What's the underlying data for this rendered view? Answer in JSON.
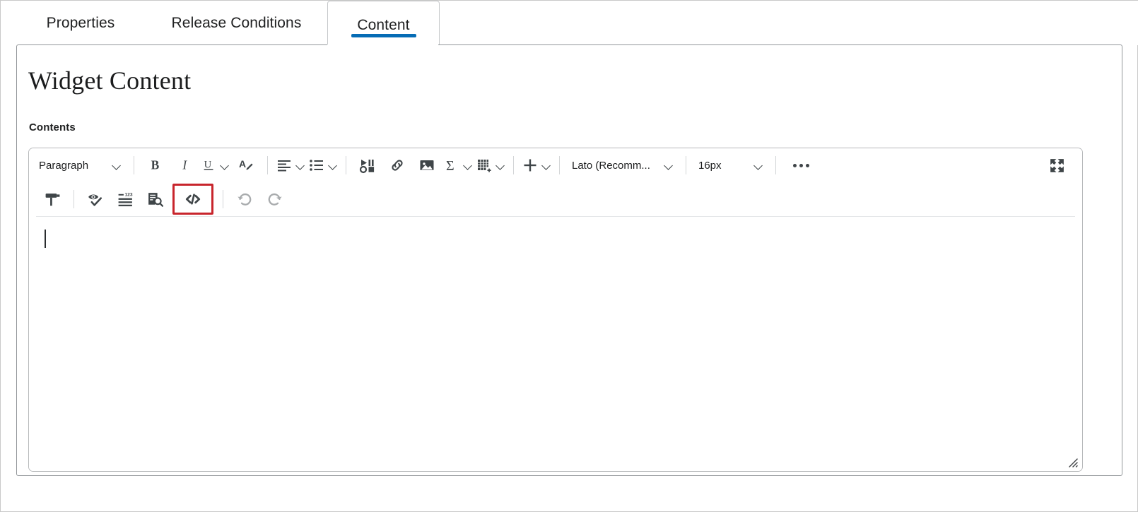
{
  "tabs": [
    {
      "id": "properties",
      "label": "Properties",
      "active": false
    },
    {
      "id": "release_conditions",
      "label": "Release Conditions",
      "active": false
    },
    {
      "id": "content",
      "label": "Content",
      "active": true
    }
  ],
  "panel": {
    "title": "Widget Content",
    "field_label": "Contents"
  },
  "editor": {
    "toolbar_row_1": [
      {
        "name": "paragraph-style-select",
        "type": "select",
        "value": "Paragraph"
      },
      {
        "name": "bold-button",
        "type": "icon",
        "icon": "bold-icon",
        "tooltip": "Bold"
      },
      {
        "name": "italic-button",
        "type": "icon",
        "icon": "italic-icon",
        "tooltip": "Italic"
      },
      {
        "name": "underline-button",
        "type": "split",
        "icon": "underline-icon",
        "tooltip": "Underline"
      },
      {
        "name": "text-color-button",
        "type": "icon",
        "icon": "text-color-icon",
        "tooltip": "Font Color"
      },
      {
        "name": "align-button",
        "type": "split",
        "icon": "align-left-icon",
        "tooltip": "Alignment"
      },
      {
        "name": "list-button",
        "type": "split",
        "icon": "bulleted-list-icon",
        "tooltip": "Lists"
      },
      {
        "name": "insert-media-button",
        "type": "icon",
        "icon": "media-icon",
        "tooltip": "Insert Stuff"
      },
      {
        "name": "insert-link-button",
        "type": "icon",
        "icon": "link-icon",
        "tooltip": "Insert Quicklink"
      },
      {
        "name": "insert-image-button",
        "type": "icon",
        "icon": "image-icon",
        "tooltip": "Insert Image"
      },
      {
        "name": "insert-equation-button",
        "type": "split",
        "icon": "sigma-icon",
        "tooltip": "Insert Equation"
      },
      {
        "name": "insert-table-button",
        "type": "split",
        "icon": "table-icon",
        "tooltip": "Insert Table"
      },
      {
        "name": "insert-more-button",
        "type": "split",
        "icon": "plus-icon",
        "tooltip": "Insert"
      },
      {
        "name": "font-family-select",
        "type": "select",
        "value": "Lato (Recomm..."
      },
      {
        "name": "font-size-select",
        "type": "select",
        "value": "16px"
      },
      {
        "name": "more-options-button",
        "type": "icon",
        "icon": "ellipsis-icon",
        "tooltip": "More"
      },
      {
        "name": "fullscreen-button",
        "type": "icon",
        "icon": "fullscreen-icon",
        "tooltip": "Full Screen"
      }
    ],
    "toolbar_row_2": [
      {
        "name": "format-painter-button",
        "type": "icon",
        "icon": "format-painter-icon",
        "tooltip": "Format Painter"
      },
      {
        "name": "accessibility-check-button",
        "type": "icon",
        "icon": "accessibility-check-icon",
        "tooltip": "Check Accessibility"
      },
      {
        "name": "word-count-button",
        "type": "icon",
        "icon": "word-count-icon",
        "tooltip": "Word Count"
      },
      {
        "name": "preview-button",
        "type": "icon",
        "icon": "preview-icon",
        "tooltip": "Preview"
      },
      {
        "name": "source-code-button",
        "type": "icon",
        "icon": "html-source-icon",
        "tooltip": "Source Code",
        "highlighted": true
      },
      {
        "name": "undo-button",
        "type": "icon",
        "icon": "undo-icon",
        "tooltip": "Undo",
        "disabled": true
      },
      {
        "name": "redo-button",
        "type": "icon",
        "icon": "redo-icon",
        "tooltip": "Redo",
        "disabled": true
      }
    ],
    "content_text": "",
    "resize_handle": "resize-grip-icon"
  },
  "colors": {
    "accent_blue": "#066cb5",
    "highlight_red": "#c8252c",
    "icon_gray": "#3f4548",
    "disabled_gray": "#a8abad",
    "border_gray": "#b6b8ba",
    "panel_border": "#929699"
  }
}
